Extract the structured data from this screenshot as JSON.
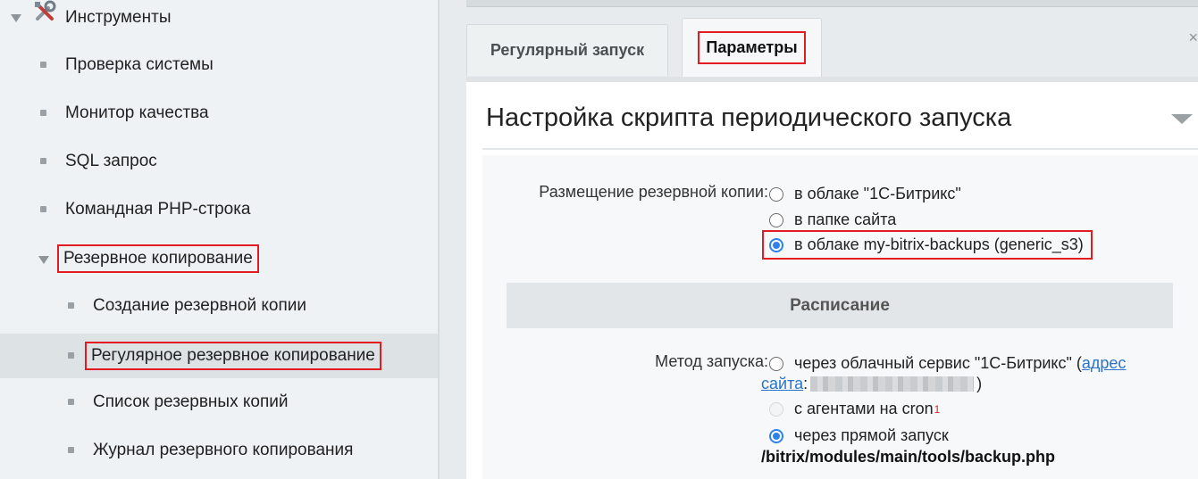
{
  "sidebar": {
    "root_label": "Инструменты",
    "items": [
      {
        "label": "Проверка системы"
      },
      {
        "label": "Монитор качества"
      },
      {
        "label": "SQL запрос"
      },
      {
        "label": "Командная PHP-строка"
      },
      {
        "label": "Резервное копирование"
      }
    ],
    "subitems": [
      {
        "label": "Создание резервной копии"
      },
      {
        "label": "Регулярное резервное копирование"
      },
      {
        "label": "Список резервных копий"
      },
      {
        "label": "Журнал резервного копирования"
      }
    ]
  },
  "tabs": [
    {
      "label": "Регулярный запуск"
    },
    {
      "label": "Параметры"
    }
  ],
  "tabs_close": "×",
  "panel": {
    "title": "Настройка скрипта периодического запуска"
  },
  "placement": {
    "label": "Размещение резервной копии:",
    "options": [
      {
        "label": "в облаке \"1С-Битрикс\"",
        "checked": false
      },
      {
        "label": "в папке сайта",
        "checked": false
      },
      {
        "label": "в облаке my-bitrix-backups (generic_s3)",
        "checked": true
      }
    ]
  },
  "schedule": {
    "section_title": "Расписание",
    "method_label": "Метод запуска:",
    "option1_text": "через облачный сервис \"1С-Битрикс\" (",
    "option1_link_part1": "адрес",
    "option1_link_part2": "сайта",
    "option1_after_link": ":",
    "option1_close": ")",
    "option2_text": "с агентами на cron",
    "option2_sup": "1",
    "option3_text": "через прямой запуск",
    "option3_path": "/bitrix/modules/main/tools/backup.php"
  },
  "colors": {
    "highlight": "#e31c23",
    "radio_checked": "#2f80ed",
    "link": "#2a73c7"
  }
}
